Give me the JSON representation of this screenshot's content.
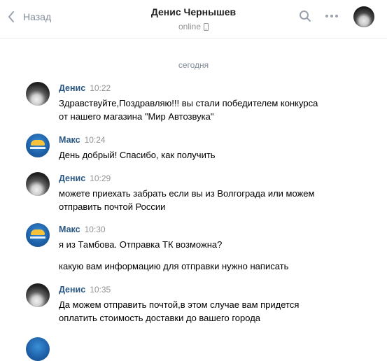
{
  "header": {
    "back_label": "Назад",
    "contact_name": "Денис Чернышев",
    "status": "online"
  },
  "date_separator": "сегодня",
  "messages": [
    {
      "author": "Денис",
      "time": "10:22",
      "lines": [
        "Здравствуйте,Поздравляю!!! вы стали победителем конкурса",
        "от нашего магазина \"Мир Автозвука\""
      ]
    },
    {
      "author": "Макс",
      "time": "10:24",
      "lines": [
        "День добрый! Спасибо, как получить"
      ]
    },
    {
      "author": "Денис",
      "time": "10:29",
      "lines": [
        "можете приехать забрать если вы из Волгограда или можем",
        "отправить почтой России"
      ]
    },
    {
      "author": "Макс",
      "time": "10:30",
      "lines": [
        "я из Тамбова. Отправка ТК возможна?"
      ],
      "followup": "какую вам информацию для отправки нужно написать"
    },
    {
      "author": "Денис",
      "time": "10:35",
      "lines": [
        "Да можем отправить почтой,в этом случае вам придется",
        "оплатить стоимость доставки до вашего города"
      ]
    }
  ],
  "colors": {
    "accent_name": "#2a5885",
    "muted": "#818c99",
    "divider": "#e7e8ec"
  }
}
